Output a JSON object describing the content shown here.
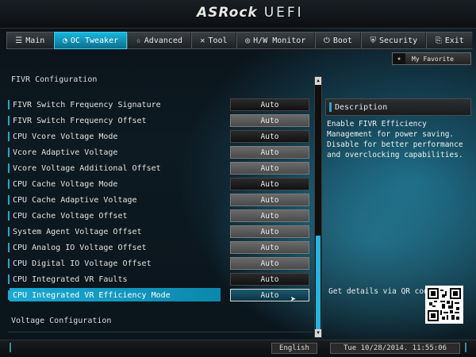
{
  "app": {
    "brand": "ASRock",
    "product": "UEFI"
  },
  "tabs": [
    {
      "label": "Main",
      "icon": "list-icon",
      "glyph": "☰",
      "active": false
    },
    {
      "label": "OC Tweaker",
      "icon": "speedometer-icon",
      "glyph": "◔",
      "active": true
    },
    {
      "label": "Advanced",
      "icon": "star-icon",
      "glyph": "☆",
      "active": false
    },
    {
      "label": "Tool",
      "icon": "tool-icon",
      "glyph": "✕",
      "active": false
    },
    {
      "label": "H/W Monitor",
      "icon": "monitor-icon",
      "glyph": "◎",
      "active": false
    },
    {
      "label": "Boot",
      "icon": "power-icon",
      "glyph": "⏻",
      "active": false
    },
    {
      "label": "Security",
      "icon": "shield-icon",
      "glyph": "⛨",
      "active": false
    },
    {
      "label": "Exit",
      "icon": "exit-icon",
      "glyph": "⎘",
      "active": false
    }
  ],
  "favorite": {
    "label": "My Favorite",
    "icon": "star-icon"
  },
  "section": {
    "title": "FIVR Configuration",
    "next_title": "Voltage Configuration"
  },
  "settings": [
    {
      "label": "FIVR Switch Frequency Signature",
      "value": "Auto",
      "style": "dark"
    },
    {
      "label": "FIVR Switch Frequency Offset",
      "value": "Auto",
      "style": "grey"
    },
    {
      "label": "CPU Vcore Voltage Mode",
      "value": "Auto",
      "style": "dark"
    },
    {
      "label": "Vcore Adaptive Voltage",
      "value": "Auto",
      "style": "grey"
    },
    {
      "label": "Vcore Voltage Additional Offset",
      "value": "Auto",
      "style": "grey"
    },
    {
      "label": "CPU Cache Voltage Mode",
      "value": "Auto",
      "style": "dark"
    },
    {
      "label": "CPU Cache Adaptive Voltage",
      "value": "Auto",
      "style": "grey"
    },
    {
      "label": "CPU Cache Voltage Offset",
      "value": "Auto",
      "style": "grey"
    },
    {
      "label": "System Agent Voltage Offset",
      "value": "Auto",
      "style": "grey"
    },
    {
      "label": "CPU Analog IO Voltage Offset",
      "value": "Auto",
      "style": "grey"
    },
    {
      "label": "CPU Digital IO Voltage Offset",
      "value": "Auto",
      "style": "grey"
    },
    {
      "label": "CPU Integrated VR Faults",
      "value": "Auto",
      "style": "dark"
    },
    {
      "label": "CPU Integrated VR Efficiency Mode",
      "value": "Auto",
      "style": "dark",
      "selected": true
    }
  ],
  "description": {
    "title": "Description",
    "body": "Enable FIVR Efficiency Management for power saving. Disable for better performance and overclocking capabilities."
  },
  "qr": {
    "label": "Get details via QR code"
  },
  "footer": {
    "language": "English",
    "datetime": "Tue 10/28/2014. 11:55:06"
  },
  "colors": {
    "accent": "#1aa9d3",
    "active_tab": "#19b7dd",
    "scroll_thumb": "#25b4e0"
  }
}
